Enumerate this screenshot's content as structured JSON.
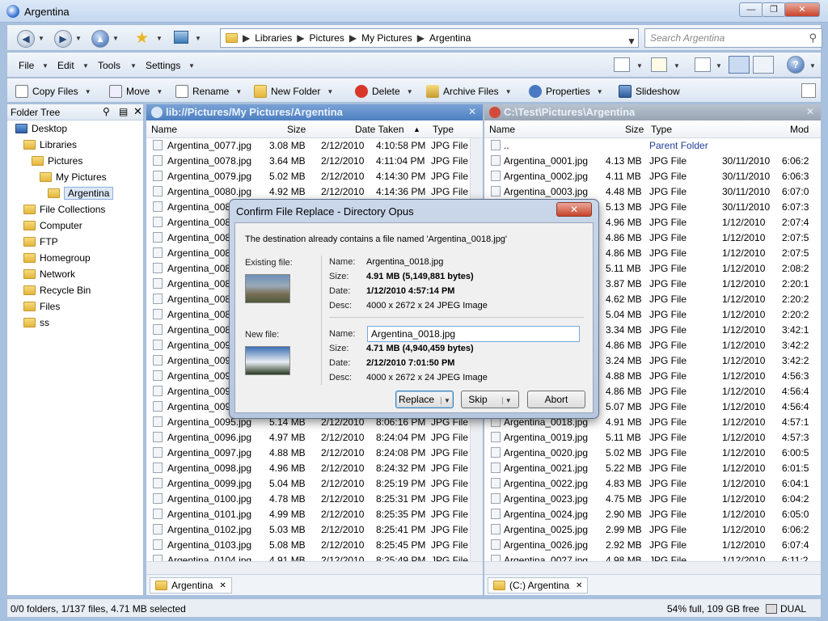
{
  "window": {
    "title": "Argentina"
  },
  "navbar": {
    "breadcrumb": [
      "Libraries",
      "Pictures",
      "My Pictures",
      "Argentina"
    ],
    "search_placeholder": "Search Argentina"
  },
  "menubar": {
    "items": [
      "File",
      "Edit",
      "Tools",
      "Settings"
    ]
  },
  "toolbar": {
    "items": [
      "Copy Files",
      "Move",
      "Rename",
      "New Folder",
      "Delete",
      "Archive Files",
      "Properties",
      "Slideshow"
    ]
  },
  "tree": {
    "title": "Folder Tree",
    "nodes": [
      {
        "label": "Desktop",
        "level": 0
      },
      {
        "label": "Libraries",
        "level": 1
      },
      {
        "label": "Pictures",
        "level": 2
      },
      {
        "label": "My Pictures",
        "level": 3
      },
      {
        "label": "Argentina",
        "level": 4,
        "selected": true
      },
      {
        "label": "File Collections",
        "level": 1
      },
      {
        "label": "Computer",
        "level": 1
      },
      {
        "label": "FTP",
        "level": 1
      },
      {
        "label": "Homegroup",
        "level": 1
      },
      {
        "label": "Network",
        "level": 1
      },
      {
        "label": "Recycle Bin",
        "level": 1
      },
      {
        "label": "Files",
        "level": 1
      },
      {
        "label": "ss",
        "level": 1
      }
    ]
  },
  "left_pane": {
    "path": "lib://Pictures/My Pictures/Argentina",
    "columns": [
      "Name",
      "Size",
      "Date Taken",
      "Type"
    ],
    "tab": "Argentina",
    "rows": [
      [
        "Argentina_0077.jpg",
        "3.08 MB",
        "2/12/2010",
        "4:10:58 PM",
        "JPG File"
      ],
      [
        "Argentina_0078.jpg",
        "3.64 MB",
        "2/12/2010",
        "4:11:04 PM",
        "JPG File"
      ],
      [
        "Argentina_0079.jpg",
        "5.02 MB",
        "2/12/2010",
        "4:14:30 PM",
        "JPG File"
      ],
      [
        "Argentina_0080.jpg",
        "4.92 MB",
        "2/12/2010",
        "4:14:36 PM",
        "JPG File"
      ],
      [
        "Argentina_008",
        "",
        "",
        "",
        ""
      ],
      [
        "Argentina_008",
        "",
        "",
        "",
        ""
      ],
      [
        "Argentina_008",
        "",
        "",
        "",
        ""
      ],
      [
        "Argentina_008",
        "",
        "",
        "",
        ""
      ],
      [
        "Argentina_008",
        "",
        "",
        "",
        ""
      ],
      [
        "Argentina_008",
        "",
        "",
        "",
        ""
      ],
      [
        "Argentina_008",
        "",
        "",
        "",
        ""
      ],
      [
        "Argentina_008",
        "",
        "",
        "",
        ""
      ],
      [
        "Argentina_008",
        "",
        "",
        "",
        ""
      ],
      [
        "Argentina_009",
        "",
        "",
        "",
        ""
      ],
      [
        "Argentina_009",
        "",
        "",
        "",
        ""
      ],
      [
        "Argentina_009",
        "",
        "",
        "",
        ""
      ],
      [
        "Argentina_009",
        "",
        "",
        "",
        ""
      ],
      [
        "Argentina_009",
        "",
        "",
        "",
        ""
      ],
      [
        "Argentina_0095.jpg",
        "5.14 MB",
        "2/12/2010",
        "8:06:16 PM",
        "JPG File"
      ],
      [
        "Argentina_0096.jpg",
        "4.97 MB",
        "2/12/2010",
        "8:24:04 PM",
        "JPG File"
      ],
      [
        "Argentina_0097.jpg",
        "4.88 MB",
        "2/12/2010",
        "8:24:08 PM",
        "JPG File"
      ],
      [
        "Argentina_0098.jpg",
        "4.96 MB",
        "2/12/2010",
        "8:24:32 PM",
        "JPG File"
      ],
      [
        "Argentina_0099.jpg",
        "5.04 MB",
        "2/12/2010",
        "8:25:19 PM",
        "JPG File"
      ],
      [
        "Argentina_0100.jpg",
        "4.78 MB",
        "2/12/2010",
        "8:25:31 PM",
        "JPG File"
      ],
      [
        "Argentina_0101.jpg",
        "4.99 MB",
        "2/12/2010",
        "8:25:35 PM",
        "JPG File"
      ],
      [
        "Argentina_0102.jpg",
        "5.03 MB",
        "2/12/2010",
        "8:25:41 PM",
        "JPG File"
      ],
      [
        "Argentina_0103.jpg",
        "5.08 MB",
        "2/12/2010",
        "8:25:45 PM",
        "JPG File"
      ],
      [
        "Argentina_0104.jpg",
        "4.91 MB",
        "2/12/2010",
        "8:25:49 PM",
        "JPG File"
      ]
    ]
  },
  "right_pane": {
    "path": "C:\\Test\\Pictures\\Argentina",
    "columns": [
      "Name",
      "Size",
      "Type",
      "Mod"
    ],
    "tab": "(C:) Argentina",
    "rows": [
      [
        "..",
        "",
        "Parent Folder",
        "",
        ""
      ],
      [
        "Argentina_0001.jpg",
        "4.13 MB",
        "JPG File",
        "30/11/2010",
        "6:06:2"
      ],
      [
        "Argentina_0002.jpg",
        "4.11 MB",
        "JPG File",
        "30/11/2010",
        "6:06:3"
      ],
      [
        "Argentina_0003.jpg",
        "4.48 MB",
        "JPG File",
        "30/11/2010",
        "6:07:0"
      ],
      [
        "",
        "5.13 MB",
        "JPG File",
        "30/11/2010",
        "6:07:3"
      ],
      [
        "",
        "4.96 MB",
        "JPG File",
        "1/12/2010",
        "2:07:4"
      ],
      [
        "",
        "4.86 MB",
        "JPG File",
        "1/12/2010",
        "2:07:5"
      ],
      [
        "",
        "4.86 MB",
        "JPG File",
        "1/12/2010",
        "2:07:5"
      ],
      [
        "",
        "5.11 MB",
        "JPG File",
        "1/12/2010",
        "2:08:2"
      ],
      [
        "",
        "3.87 MB",
        "JPG File",
        "1/12/2010",
        "2:20:1"
      ],
      [
        "",
        "4.62 MB",
        "JPG File",
        "1/12/2010",
        "2:20:2"
      ],
      [
        "",
        "5.04 MB",
        "JPG File",
        "1/12/2010",
        "2:20:2"
      ],
      [
        "",
        "3.34 MB",
        "JPG File",
        "1/12/2010",
        "3:42:1"
      ],
      [
        "",
        "4.86 MB",
        "JPG File",
        "1/12/2010",
        "3:42:2"
      ],
      [
        "",
        "3.24 MB",
        "JPG File",
        "1/12/2010",
        "3:42:2"
      ],
      [
        "",
        "4.88 MB",
        "JPG File",
        "1/12/2010",
        "4:56:3"
      ],
      [
        "",
        "4.86 MB",
        "JPG File",
        "1/12/2010",
        "4:56:4"
      ],
      [
        "",
        "5.07 MB",
        "JPG File",
        "1/12/2010",
        "4:56:4"
      ],
      [
        "Argentina_0018.jpg",
        "4.91 MB",
        "JPG File",
        "1/12/2010",
        "4:57:1"
      ],
      [
        "Argentina_0019.jpg",
        "5.11 MB",
        "JPG File",
        "1/12/2010",
        "4:57:3"
      ],
      [
        "Argentina_0020.jpg",
        "5.02 MB",
        "JPG File",
        "1/12/2010",
        "6:00:5"
      ],
      [
        "Argentina_0021.jpg",
        "5.22 MB",
        "JPG File",
        "1/12/2010",
        "6:01:5"
      ],
      [
        "Argentina_0022.jpg",
        "4.83 MB",
        "JPG File",
        "1/12/2010",
        "6:04:1"
      ],
      [
        "Argentina_0023.jpg",
        "4.75 MB",
        "JPG File",
        "1/12/2010",
        "6:04:2"
      ],
      [
        "Argentina_0024.jpg",
        "2.90 MB",
        "JPG File",
        "1/12/2010",
        "6:05:0"
      ],
      [
        "Argentina_0025.jpg",
        "2.99 MB",
        "JPG File",
        "1/12/2010",
        "6:06:2"
      ],
      [
        "Argentina_0026.jpg",
        "2.92 MB",
        "JPG File",
        "1/12/2010",
        "6:07:4"
      ],
      [
        "Argentina_0027.jpg",
        "4.98 MB",
        "JPG File",
        "1/12/2010",
        "6:11:2"
      ]
    ]
  },
  "status": {
    "left": "0/0 folders, 1/137 files, 4.71 MB selected",
    "right": "54% full, 109 GB free",
    "mode": "DUAL"
  },
  "dialog": {
    "title": "Confirm File Replace - Directory Opus",
    "message": "The destination already contains a file named 'Argentina_0018.jpg'",
    "existing_label": "Existing file:",
    "new_label": "New file:",
    "labels": {
      "name": "Name:",
      "size": "Size:",
      "date": "Date:",
      "desc": "Desc:"
    },
    "existing": {
      "name": "Argentina_0018.jpg",
      "size": "4.91 MB (5,149,881 bytes)",
      "date": "1/12/2010 4:57:14 PM",
      "desc": "4000 x 2672 x 24 JPEG Image"
    },
    "new": {
      "name": "Argentina_0018.jpg",
      "size": "4.71 MB (4,940,459 bytes)",
      "date": "2/12/2010 7:01:50 PM",
      "desc": "4000 x 2672 x 24 JPEG Image"
    },
    "buttons": {
      "replace": "Replace",
      "skip": "Skip",
      "abort": "Abort"
    }
  }
}
